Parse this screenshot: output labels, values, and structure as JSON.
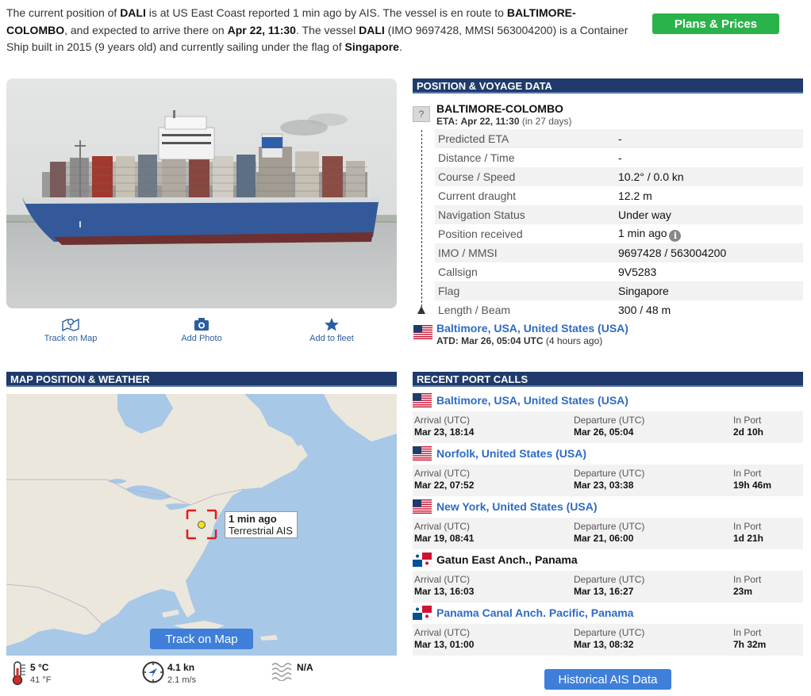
{
  "intro": {
    "p1": "The current position of ",
    "name": "DALI",
    "p2": " is at US East Coast reported 1 min ago by AIS. The vessel is en route to ",
    "dest": "BALTIMORE-COLOMBO",
    "p3": ", and expected to arrive there on ",
    "eta": "Apr 22, 11:30",
    "p4": ". The vessel ",
    "name2": "DALI",
    "p5": " (IMO 9697428, MMSI 563004200) is a Container Ship built in 2015 (9 years old) and currently sailing under the flag of ",
    "flag": "Singapore",
    "p6": "."
  },
  "plans_button": "Plans & Prices",
  "photo_actions": {
    "track": "Track on Map",
    "photo": "Add Photo",
    "fleet": "Add to fleet"
  },
  "voyage": {
    "header": "POSITION & VOYAGE DATA",
    "dest_icon": "?",
    "destination": "BALTIMORE-COLOMBO",
    "eta_label": "ETA:",
    "eta_value": "Apr 22, 11:30",
    "eta_rel": "(in 27 days)",
    "rows": [
      {
        "k": "Predicted ETA",
        "v": "-"
      },
      {
        "k": "Distance / Time",
        "v": "-"
      },
      {
        "k": "Course / Speed",
        "v": "10.2° / 0.0 kn"
      },
      {
        "k": "Current draught",
        "v": "12.2 m"
      },
      {
        "k": "Navigation Status",
        "v": "Under way"
      },
      {
        "k": "Position received",
        "v": "1 min ago"
      },
      {
        "k": "IMO / MMSI",
        "v": "9697428 / 563004200"
      },
      {
        "k": "Callsign",
        "v": "9V5283"
      },
      {
        "k": "Flag",
        "v": "Singapore"
      },
      {
        "k": "Length / Beam",
        "v": "300 / 48 m"
      }
    ],
    "info_glyph": "i",
    "departure_port": "Baltimore, USA, United States (USA)",
    "atd_label": "ATD:",
    "atd_value": "Mar 26, 05:04 UTC",
    "atd_rel": "(4 hours ago)"
  },
  "map": {
    "header": "MAP POSITION & WEATHER",
    "pos_time": "1 min ago",
    "pos_source": "Terrestrial AIS",
    "track_button": "Track on Map"
  },
  "weather": {
    "temp_c": "5 °C",
    "temp_f": "41 °F",
    "wind_kn": "4.1 kn",
    "wind_ms": "2.1 m/s",
    "waves": "N/A"
  },
  "port_calls": {
    "header": "RECENT PORT CALLS",
    "arrival_label": "Arrival (UTC)",
    "departure_label": "Departure (UTC)",
    "inport_label": "In Port",
    "items": [
      {
        "name": "Baltimore, USA, United States (USA)",
        "flag": "usa",
        "link": true,
        "arrival": "Mar 23, 18:14",
        "departure": "Mar 26, 05:04",
        "inport": "2d 10h"
      },
      {
        "name": "Norfolk, United States (USA)",
        "flag": "usa",
        "link": true,
        "arrival": "Mar 22, 07:52",
        "departure": "Mar 23, 03:38",
        "inport": "19h 46m"
      },
      {
        "name": "New York, United States (USA)",
        "flag": "usa",
        "link": true,
        "arrival": "Mar 19, 08:41",
        "departure": "Mar 21, 06:00",
        "inport": "1d 21h"
      },
      {
        "name": "Gatun East Anch., Panama",
        "flag": "panama",
        "link": false,
        "arrival": "Mar 13, 16:03",
        "departure": "Mar 13, 16:27",
        "inport": "23m"
      },
      {
        "name": "Panama Canal Anch. Pacific, Panama",
        "flag": "panama",
        "link": true,
        "arrival": "Mar 13, 01:00",
        "departure": "Mar 13, 08:32",
        "inport": "7h 32m"
      }
    ],
    "history_button": "Historical AIS Data"
  },
  "colors": {
    "header_bg": "#1f3a6b",
    "link": "#2d6bc4",
    "green_button": "#2bb34b",
    "blue_button": "#3f7fd9"
  }
}
